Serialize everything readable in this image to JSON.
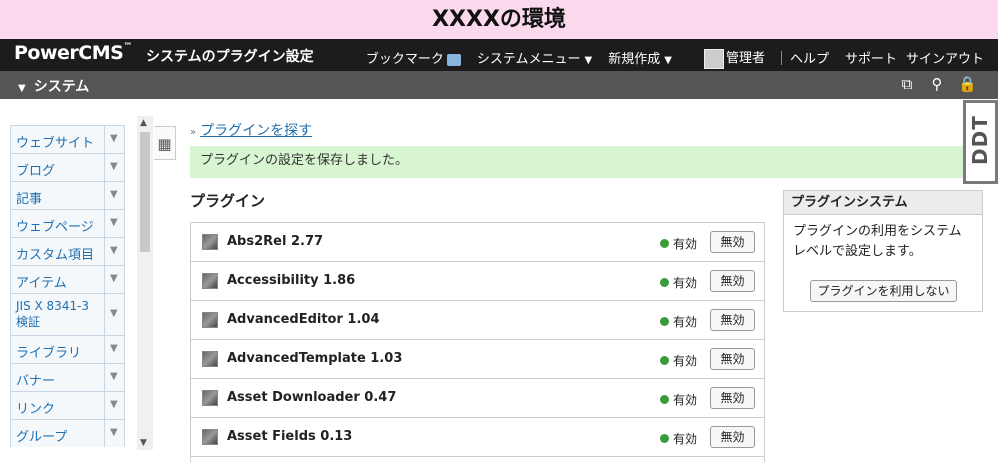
{
  "env_banner": "XXXXの環境",
  "topbar": {
    "logo": "PowerCMS",
    "logo_tm": "™",
    "page_title": "システムのプラグイン設定",
    "bookmark": "ブックマーク",
    "system_menu": "システムメニュー",
    "new_create": "新規作成",
    "user": "管理者",
    "help": "ヘルプ",
    "support": "サポート",
    "signout": "サインアウト"
  },
  "sysbar": {
    "label": "システム"
  },
  "sidebar": {
    "items": [
      {
        "label": "ウェブサイト"
      },
      {
        "label": "ブログ"
      },
      {
        "label": "記事"
      },
      {
        "label": "ウェブページ"
      },
      {
        "label": "カスタム項目"
      },
      {
        "label": "アイテム"
      },
      {
        "label": "JIS X 8341-3 検証"
      },
      {
        "label": "ライブラリ"
      },
      {
        "label": "バナー"
      },
      {
        "label": "リンク"
      },
      {
        "label": "グループ"
      }
    ]
  },
  "main": {
    "find_link": "プラグインを探す",
    "message": "プラグインの設定を保存しました。",
    "section_title": "プラグイン",
    "plugins": [
      {
        "name": "Abs2Rel 2.77",
        "status": "有効",
        "button": "無効"
      },
      {
        "name": "Accessibility 1.86",
        "status": "有効",
        "button": "無効"
      },
      {
        "name": "AdvancedEditor 1.04",
        "status": "有効",
        "button": "無効"
      },
      {
        "name": "AdvancedTemplate 1.03",
        "status": "有効",
        "button": "無効"
      },
      {
        "name": "Asset Downloader 0.47",
        "status": "有効",
        "button": "無効"
      },
      {
        "name": "Asset Fields 0.13",
        "status": "有効",
        "button": "無効"
      }
    ]
  },
  "plugin_system": {
    "title": "プラグインシステム",
    "description": "プラグインの利用をシステムレベルで設定します。",
    "button": "プラグインを利用しない"
  },
  "ddt": {
    "label": "DDT"
  },
  "colors": {
    "banner": "#fbd9ec",
    "topbar": "#1c1c1c",
    "sysbar": "#555555",
    "success": "#d7f5d1",
    "link": "#1f6fb2"
  }
}
